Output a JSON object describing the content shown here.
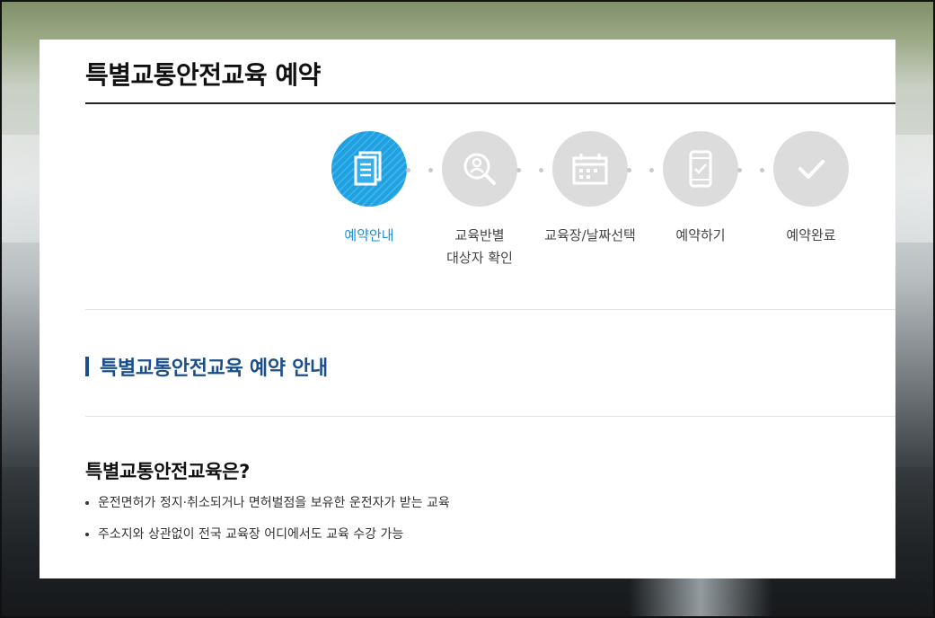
{
  "page": {
    "title": "특별교통안전교육 예약"
  },
  "steps": [
    {
      "label": "예약안내",
      "icon": "document-icon",
      "active": true
    },
    {
      "label": "교육반별\n대상자 확인",
      "icon": "user-search-icon",
      "active": false
    },
    {
      "label": "교육장/날짜선택",
      "icon": "calendar-icon",
      "active": false
    },
    {
      "label": "예약하기",
      "icon": "mobile-check-icon",
      "active": false
    },
    {
      "label": "예약완료",
      "icon": "check-icon",
      "active": false
    }
  ],
  "section": {
    "heading": "특별교통안전교육 예약 안내"
  },
  "intro": {
    "title": "특별교통안전교육은?",
    "items": [
      "운전면허가 정지·취소되거나 면허벌점을 보유한 운전자가 받는 교육",
      "주소지와 상관없이 전국 교육장 어디에서도 교육 수강 가능"
    ]
  },
  "colors": {
    "accent": "#1fa0e0",
    "heading": "#1a4f8a",
    "inactive_step": "#dcdcdc"
  }
}
